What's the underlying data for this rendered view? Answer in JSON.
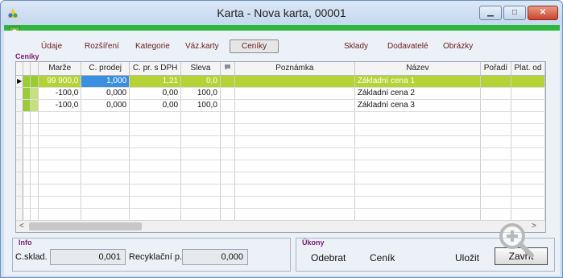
{
  "window": {
    "title": "Karta - Nova karta, 00001",
    "help_label": "?"
  },
  "tabs": [
    {
      "label": "Údaje"
    },
    {
      "label": "Rozšíření"
    },
    {
      "label": "Kategorie"
    },
    {
      "label": "Váz.karty"
    },
    {
      "label": "Ceníky",
      "active": true
    },
    {
      "label": "Sklady"
    },
    {
      "label": "Dodavatelé"
    },
    {
      "label": "Obrázky"
    }
  ],
  "grid": {
    "section_label": "Ceníky",
    "columns": [
      "Marže",
      "C. prodej",
      "C. pr. s DPH",
      "Sleva",
      "",
      "Poznámka",
      "Název",
      "Pořadí",
      "Plat. od"
    ],
    "rows": [
      {
        "marze": "99 900,0",
        "c_prodej": "1,000",
        "c_pr_s_dph": "1,21",
        "sleva": "0,0",
        "poznamka": "",
        "nazev": "Základní cena 1",
        "poradi": "",
        "plat_od": ""
      },
      {
        "marze": "-100,0",
        "c_prodej": "0,000",
        "c_pr_s_dph": "0,00",
        "sleva": "100,0",
        "poznamka": "",
        "nazev": "Základní cena 2",
        "poradi": "",
        "plat_od": ""
      },
      {
        "marze": "-100,0",
        "c_prodej": "0,000",
        "c_pr_s_dph": "0,00",
        "sleva": "100,0",
        "poznamka": "",
        "nazev": "Základní cena 3",
        "poradi": "",
        "plat_od": ""
      }
    ],
    "empty_rows": 9,
    "row_indicator": "▶",
    "scroll_left": "<",
    "scroll_right": ">"
  },
  "info": {
    "section_label": "Info",
    "c_sklad_label": "C.sklad.",
    "c_sklad_value": "0,001",
    "recyklacni_label": "Recyklační p.",
    "recyklacni_value": "0,000"
  },
  "actions": {
    "section_label": "Úkony",
    "odebrat": "Odebrat",
    "cenik": "Ceník",
    "ulozit": "Uložit",
    "zavrit": "Zavřít"
  },
  "icons": {
    "app": "app-icon",
    "minimize": "minimize-icon",
    "maximize": "maximize-icon",
    "close": "close-icon",
    "zoom": "zoom-in-icon",
    "note_column": "note-column-icon"
  },
  "colors": {
    "title_green_bar": "#2db83d",
    "selected_row": "#b5d335",
    "current_cell": "#3b8fe0",
    "section_label": "#7a1d6f",
    "tab_text": "#6a1b1b"
  }
}
